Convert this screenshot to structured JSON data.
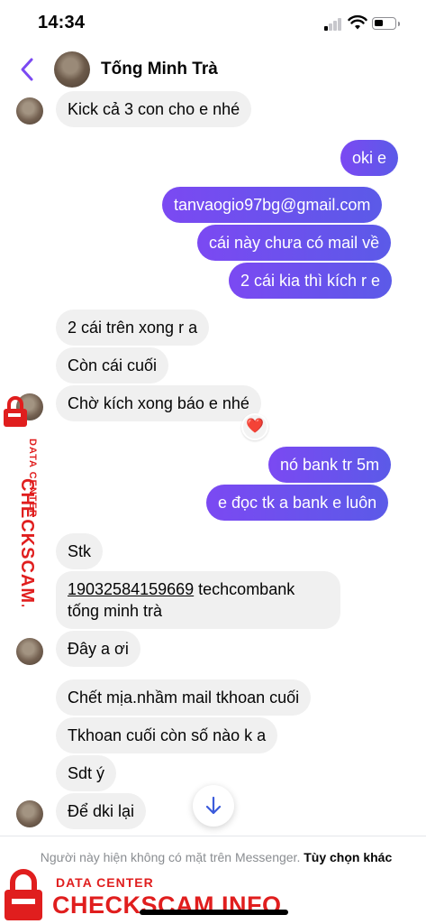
{
  "status_bar": {
    "time": "14:34"
  },
  "header": {
    "contact_name": "Tống Minh Trà"
  },
  "messages": [
    {
      "dir": "in",
      "text": "Kick cả 3 con cho e nhé"
    },
    {
      "dir": "out",
      "text": "oki e"
    },
    {
      "dir": "out",
      "text": "tanvaogio97bg@gmail.com"
    },
    {
      "dir": "out",
      "text": "cái này chưa có mail về"
    },
    {
      "dir": "out",
      "text": "2 cái kia thì kích r e"
    },
    {
      "dir": "in",
      "text": "2 cái trên xong r a"
    },
    {
      "dir": "in",
      "text": "Còn cái cuối"
    },
    {
      "dir": "in",
      "text": "Chờ kích xong báo e nhé"
    },
    {
      "dir": "out",
      "text": "nó bank tr 5m"
    },
    {
      "dir": "out",
      "text": "e đọc tk a bank e luôn"
    },
    {
      "dir": "in",
      "text": "Stk"
    },
    {
      "dir": "in",
      "account_number": "19032584159669",
      "account_rest": " techcombank",
      "account_name": "tống minh trà"
    },
    {
      "dir": "in",
      "text": "Đây a ơi"
    },
    {
      "dir": "in",
      "text": "Chết mịa.nhầm mail tkhoan cuối"
    },
    {
      "dir": "in",
      "text": "Tkhoan cuối còn số nào k a"
    },
    {
      "dir": "in",
      "text": "Sdt ý"
    },
    {
      "dir": "in",
      "text": "Để dki lại"
    }
  ],
  "reaction": {
    "emoji": "❤️",
    "icon": "heart-icon",
    "color": "#e0245e"
  },
  "footer": {
    "notice": "Người này hiện không có mặt trên Messenger.",
    "link": "Tùy chọn khác"
  },
  "watermark": {
    "sub": "DATA CENTER",
    "main": "CHECKSCAM.INFO",
    "color": "#e01e1e"
  },
  "colors": {
    "outgoing": "#6a4ff0",
    "incoming": "#f0f0f0",
    "accent": "#7b49f2"
  }
}
